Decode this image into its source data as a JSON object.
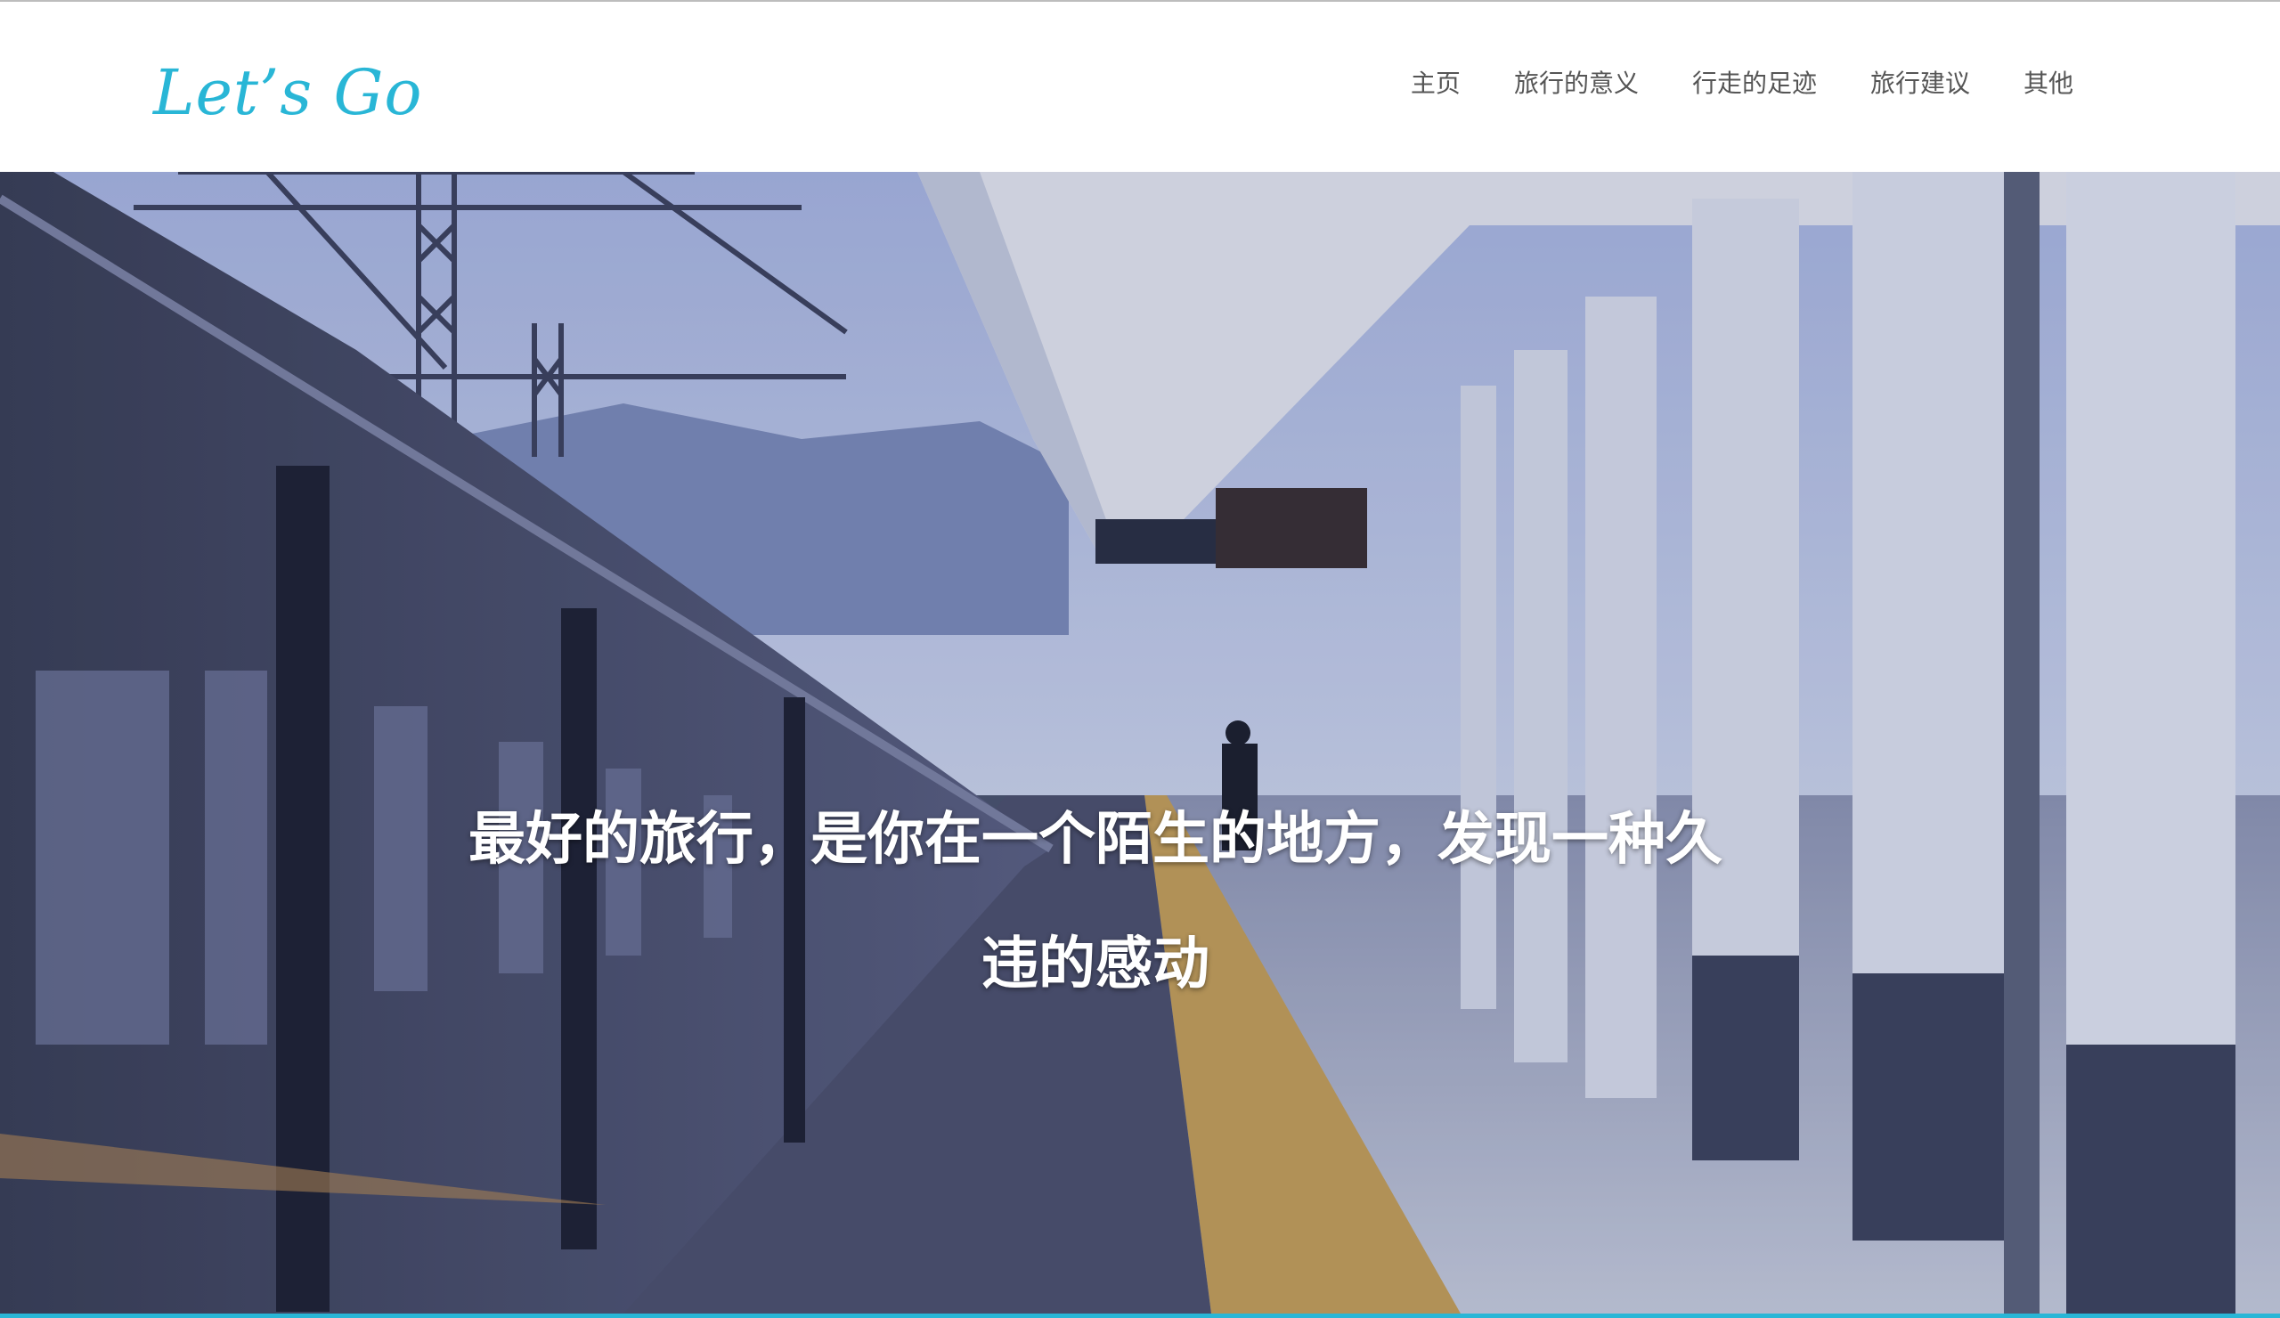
{
  "brand": {
    "logo_text": "Let’s Go",
    "accent_color": "#29b6d6"
  },
  "nav": {
    "items": [
      {
        "label": "主页"
      },
      {
        "label": "旅行的意义"
      },
      {
        "label": "行走的足迹"
      },
      {
        "label": "旅行建议"
      },
      {
        "label": "其他"
      }
    ]
  },
  "hero": {
    "headline": "最好的旅行，是你在一个陌生的地方，发现一种久违的感动",
    "image_subject": "train-station-platform"
  }
}
